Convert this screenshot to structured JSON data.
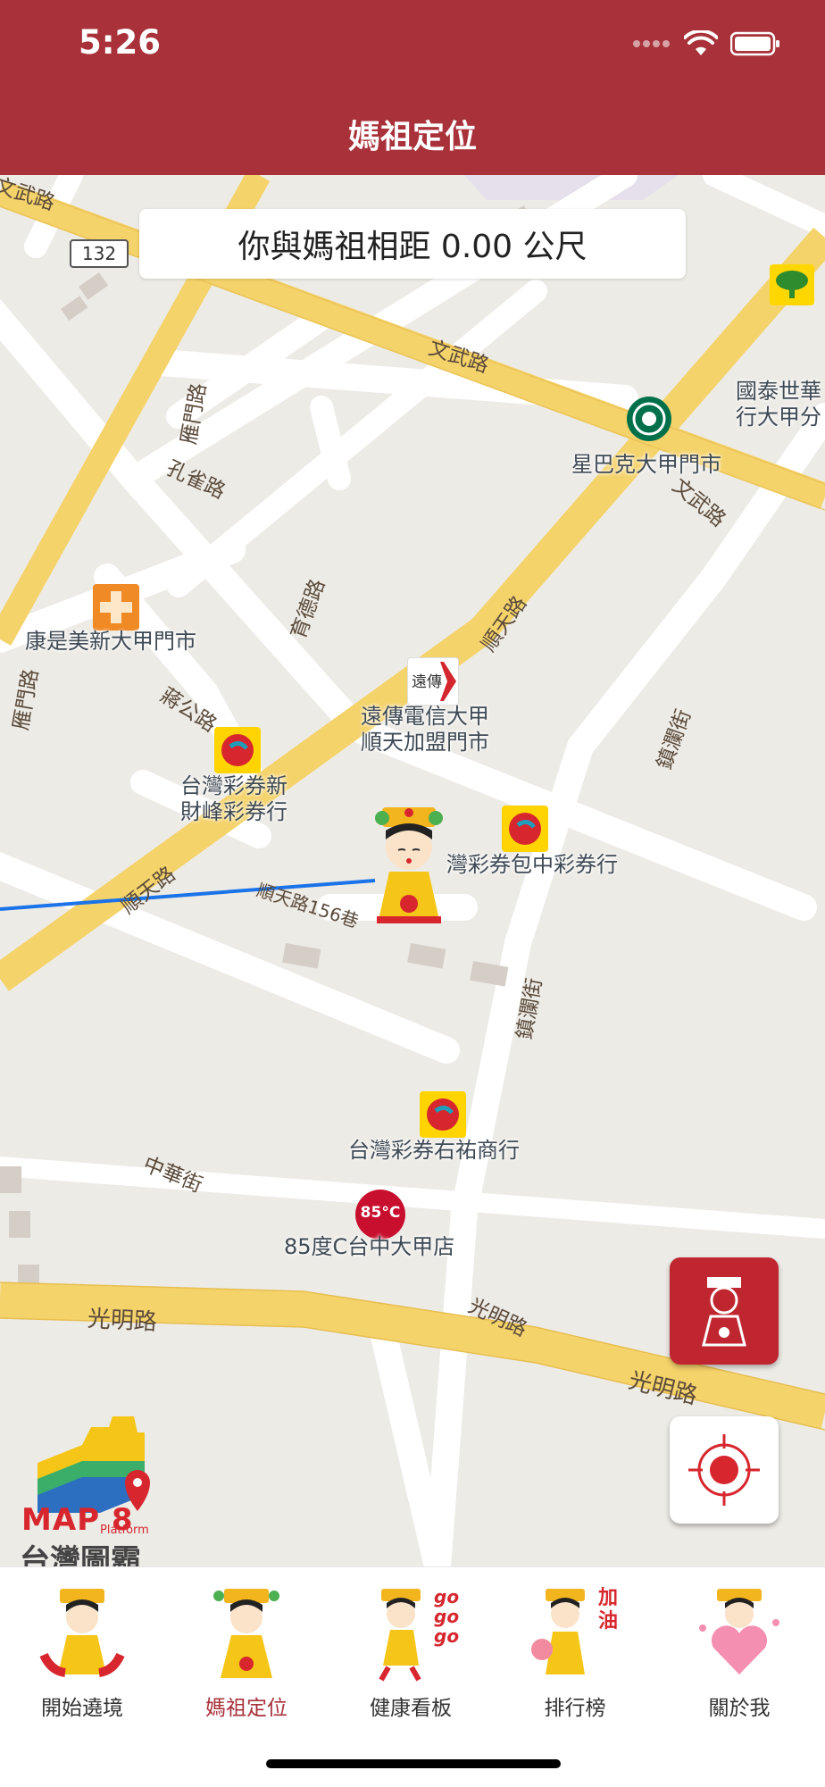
{
  "status_bar": {
    "time": "5:26"
  },
  "nav": {
    "title": "媽祖定位"
  },
  "map": {
    "distance_text": "你與媽祖相距 0.00 公尺",
    "road_number": "132",
    "streets": {
      "wenwu_1": "文武路",
      "wenwu_2": "文武路",
      "wenwu_3": "文武路",
      "yanmen_1": "雁門路",
      "yanmen_2": "雁門路",
      "kongque": "孔雀路",
      "yude": "育德路",
      "shuntian_1": "順天路",
      "shuntian_2": "順天路",
      "shuntian_156": "順天路156巷",
      "jianggong": "蔣公路",
      "zhenlan_1": "鎮瀾街",
      "zhenlan_2": "鎮瀾街",
      "zhonghua": "中華街",
      "guangming_1": "光明路",
      "guangming_2": "光明路",
      "guangming_3": "光明路"
    },
    "pois": {
      "cathay": "國泰世華\n行大甲分",
      "starbucks": "星巴克大甲門市",
      "cosmed": "康是美新大甲門市",
      "fetnet_badge": "遠傳",
      "fetnet": "遠傳電信大甲\n順天加盟門市",
      "lottery_caifeng": "台灣彩券新\n財峰彩券行",
      "lottery_baozhong": "灣彩券包中彩券行",
      "lottery_youhu": "台灣彩券右祐商行",
      "cafe85_badge": "85°C",
      "cafe85": "85度C台中大甲店"
    },
    "logo": {
      "brand": "MAP 8",
      "platform": "Platform",
      "sub": "台灣圖霸"
    }
  },
  "tabs": [
    {
      "label": "開始遶境",
      "active": false
    },
    {
      "label": "媽祖定位",
      "active": true
    },
    {
      "label": "健康看板",
      "active": false,
      "badge": "go\ngo\ngo"
    },
    {
      "label": "排行榜",
      "active": false,
      "badge": "加\n油"
    },
    {
      "label": "關於我",
      "active": false
    }
  ],
  "colors": {
    "brand_red": "#A8313A",
    "road_yellow": "#F5D36B",
    "route_blue": "#1A73E8"
  }
}
